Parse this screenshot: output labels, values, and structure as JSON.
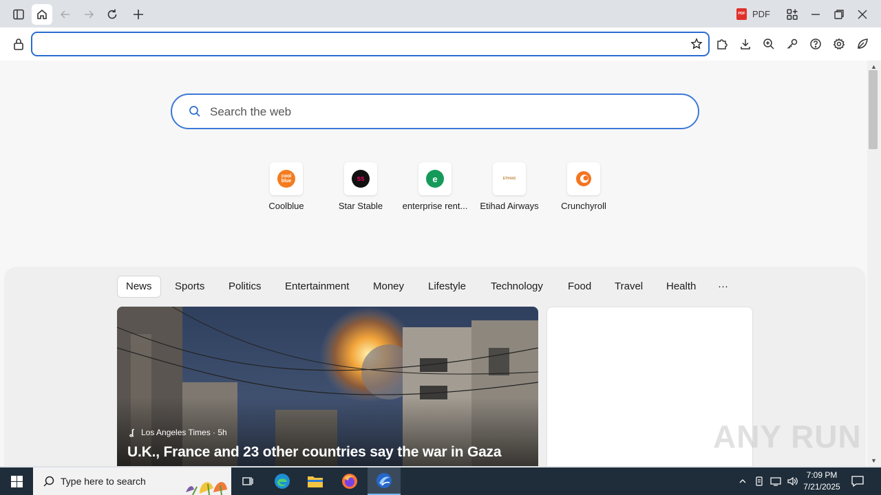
{
  "toolbar": {
    "pdf_label": "PDF",
    "pdf_badge": "PDF",
    "icons": [
      "sidebar-icon",
      "home-icon",
      "back-icon",
      "forward-icon",
      "reload-icon",
      "new-tab-icon",
      "pdf-icon",
      "apps-icon",
      "minimize-icon",
      "restore-icon",
      "close-icon"
    ]
  },
  "address_bar": {
    "value": "",
    "icons": [
      "lock-icon",
      "star-icon",
      "extensions-icon",
      "download-icon",
      "zoom-icon",
      "key-icon",
      "help-icon",
      "settings-icon",
      "leaf-icon"
    ]
  },
  "search": {
    "placeholder": "Search the web"
  },
  "tiles": [
    {
      "label": "Coolblue",
      "logo_text": "cool blue",
      "color": "#f47c20"
    },
    {
      "label": "Star Stable",
      "logo_text": "SS",
      "color": "#111111"
    },
    {
      "label": "enterprise rent...",
      "logo_text": "e",
      "color": "#169a5a"
    },
    {
      "label": "Etihad Airways",
      "logo_text": "ETIHAD",
      "color": "#bd8b43"
    },
    {
      "label": "Crunchyroll",
      "logo_text": "",
      "color": "#f47521"
    }
  ],
  "feed": {
    "tabs": [
      "News",
      "Sports",
      "Politics",
      "Entertainment",
      "Money",
      "Lifestyle",
      "Technology",
      "Food",
      "Travel",
      "Health",
      "···"
    ],
    "active_tab": "News",
    "hero": {
      "source": "Los Angeles Times · 5h",
      "source_icon": "ʆ",
      "title": "U.K., France and 23 other countries say the war in Gaza"
    }
  },
  "watermark": "ANY RUN",
  "taskbar": {
    "search_placeholder": "Type here to search",
    "apps": [
      "task-view-icon",
      "edge-icon",
      "file-explorer-icon",
      "firefox-icon",
      "browser-app-icon"
    ],
    "time": "7:09 PM",
    "date": "7/21/2025"
  },
  "colors": {
    "accent": "#2a6cd1",
    "taskbar": "#1f2d3a",
    "page_bg": "#f7f7f7"
  }
}
